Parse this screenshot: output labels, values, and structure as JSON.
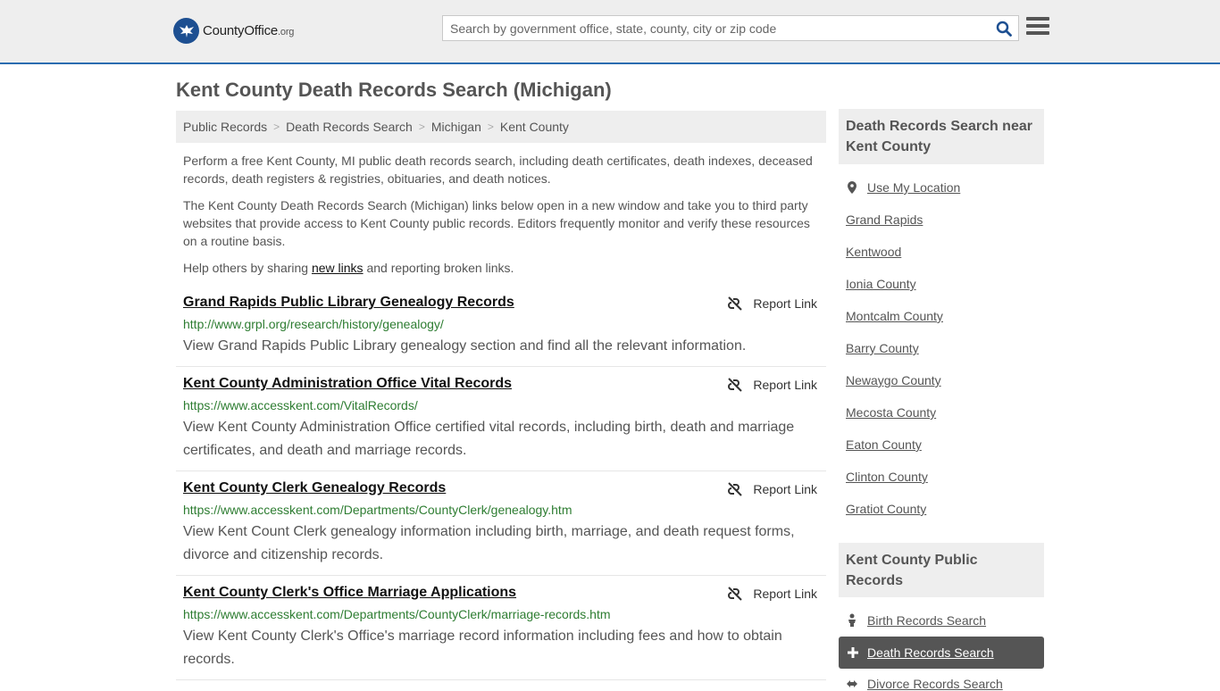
{
  "header": {
    "logo_name": "County",
    "logo_brand": "Office",
    "logo_tld": ".org",
    "search_placeholder": "Search by government office, state, county, city or zip code"
  },
  "page": {
    "title": "Kent County Death Records Search (Michigan)"
  },
  "breadcrumb": [
    "Public Records",
    "Death Records Search",
    "Michigan",
    "Kent County"
  ],
  "intro": {
    "p1": "Perform a free Kent County, MI public death records search, including death certificates, death indexes, deceased records, death registers & registries, obituaries, and death notices.",
    "p2": "The Kent County Death Records Search (Michigan) links below open in a new window and take you to third party websites that provide access to Kent County public records. Editors frequently monitor and verify these resources on a routine basis.",
    "share_before": "Help others by sharing ",
    "share_link": "new links",
    "share_after": " and reporting broken links."
  },
  "report_label": "Report Link",
  "results": [
    {
      "title": "Grand Rapids Public Library Genealogy Records",
      "url": "http://www.grpl.org/research/history/genealogy/",
      "desc": "View Grand Rapids Public Library genealogy section and find all the relevant information."
    },
    {
      "title": "Kent County Administration Office Vital Records",
      "url": "https://www.accesskent.com/VitalRecords/",
      "desc": "View Kent County Administration Office certified vital records, including birth, death and marriage certificates, and death and marriage records."
    },
    {
      "title": "Kent County Clerk Genealogy Records",
      "url": "https://www.accesskent.com/Departments/CountyClerk/genealogy.htm",
      "desc": "View Kent Count Clerk genealogy information including birth, marriage, and death request forms, divorce and citizenship records."
    },
    {
      "title": "Kent County Clerk's Office Marriage Applications",
      "url": "https://www.accesskent.com/Departments/CountyClerk/marriage-records.htm",
      "desc": "View Kent County Clerk's Office's marriage record information including fees and how to obtain records."
    }
  ],
  "sidebar": {
    "near_title": "Death Records Search near Kent County",
    "use_location": "Use My Location",
    "near_links": [
      "Grand Rapids",
      "Kentwood",
      "Ionia County",
      "Montcalm County",
      "Barry County",
      "Newaygo County",
      "Mecosta County",
      "Eaton County",
      "Clinton County",
      "Gratiot County"
    ],
    "public_title": "Kent County Public Records",
    "birth_link": "Birth Records Search",
    "death_link": "Death Records Search",
    "divorce_link": "Divorce Records Search"
  },
  "colors": {
    "accent": "#2b6cb0",
    "url_green": "#2e7d32",
    "active_bg": "#555555",
    "panel_bg": "#eeeeee"
  }
}
